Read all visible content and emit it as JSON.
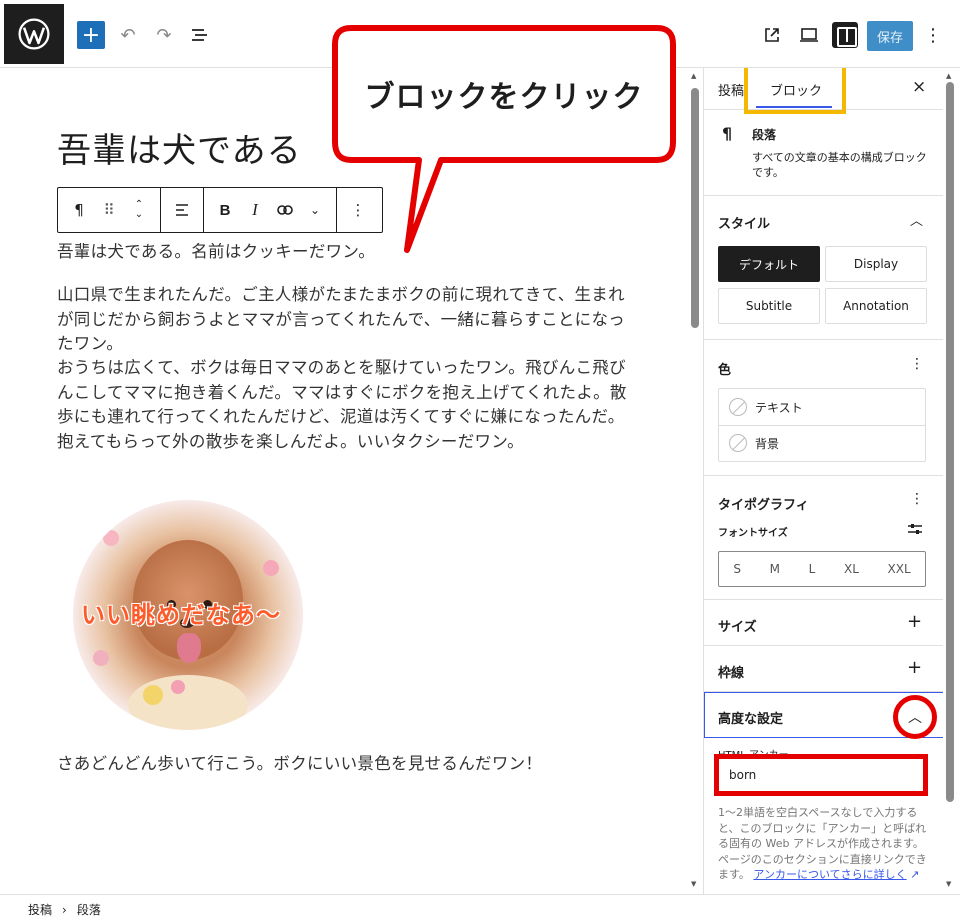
{
  "topbar": {
    "save_label": "保存",
    "icons": [
      "wordpress-logo",
      "add",
      "undo",
      "redo",
      "document-overview",
      "external-link",
      "preview-desktop",
      "sidebar-toggle",
      "more-options"
    ]
  },
  "callout": {
    "text": "ブロックをクリック"
  },
  "editor": {
    "title": "吾輩は犬である",
    "paragraphs": [
      "吾輩は犬である。名前はクッキーだワン。",
      "山口県で生まれたんだ。ご主人様がたまたまボクの前に現れてきて、生まれが同じだから飼おうよとママが言ってくれたんで、一緒に暮らすことになったワン。",
      "おうちは広くて、ボクは毎日ママのあとを駆けていったワン。飛びんこ飛びんこしてママに抱き着くんだ。ママはすぐにボクを抱え上げてくれたよ。散歩にも連れて行ってくれたんだけど、泥道は汚くてすぐに嫌になったんだ。抱えてもらって外の散歩を楽しんだよ。いいタクシーだワン。",
      "さあどんどん歩いて行こう。ボクにいい景色を見せるんだワン！"
    ],
    "image_caption": "いい眺めだなあ～"
  },
  "sidebar": {
    "tabs": [
      "投稿",
      "ブロック"
    ],
    "close": "×",
    "block_card": {
      "title": "段落",
      "description": "すべての文章の基本の構成ブロックです。"
    },
    "styles": {
      "heading": "スタイル",
      "options": [
        "デフォルト",
        "Display",
        "Subtitle",
        "Annotation"
      ],
      "active": "デフォルト"
    },
    "color": {
      "heading": "色",
      "items": [
        "テキスト",
        "背景"
      ]
    },
    "typography": {
      "heading": "タイポグラフィ",
      "font_size_label": "フォントサイズ",
      "sizes": [
        "S",
        "M",
        "L",
        "XL",
        "XXL"
      ]
    },
    "size": {
      "heading": "サイズ"
    },
    "border": {
      "heading": "枠線"
    },
    "advanced": {
      "heading": "高度な設定",
      "anchor_label": "HTML アンカー",
      "anchor_value": "born",
      "help_text": "1〜2単語を空白スペースなしで入力すると、このブロックに「アンカー」と呼ばれる固有の Web アドレスが作成されます。ページのこのセクションに直接リンクできます。",
      "help_link": "アンカーについてさらに詳しく"
    }
  },
  "footer": {
    "breadcrumb": [
      "投稿",
      "段落"
    ]
  },
  "colors": {
    "accent": "#3858e9",
    "highlight_red": "#e50000",
    "highlight_yellow": "#f5b800",
    "save_bg": "#3f8ec7"
  }
}
